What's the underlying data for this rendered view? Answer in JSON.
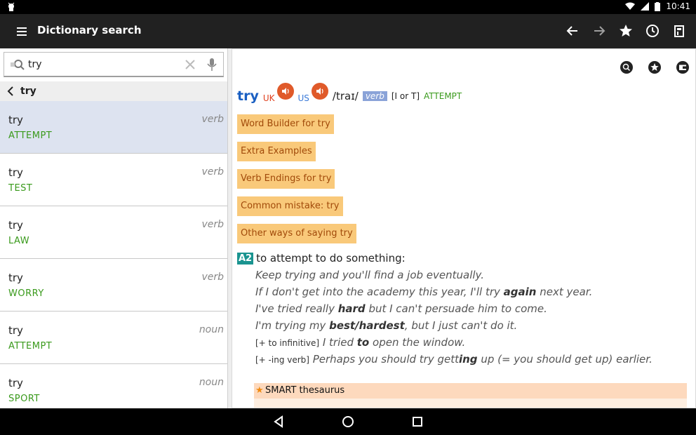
{
  "status_bar": {
    "time": "10:41"
  },
  "app_bar": {
    "title": "Dictionary search"
  },
  "search": {
    "value": "try",
    "placeholder": ""
  },
  "back_row": {
    "label": "try"
  },
  "results": [
    {
      "word": "try",
      "pos": "verb",
      "guide": "ATTEMPT"
    },
    {
      "word": "try",
      "pos": "verb",
      "guide": "TEST"
    },
    {
      "word": "try",
      "pos": "verb",
      "guide": "LAW"
    },
    {
      "word": "try",
      "pos": "verb",
      "guide": "WORRY"
    },
    {
      "word": "try",
      "pos": "noun",
      "guide": "ATTEMPT"
    },
    {
      "word": "try",
      "pos": "noun",
      "guide": "SPORT"
    }
  ],
  "entry": {
    "headword": "try",
    "uk_label": "UK",
    "us_label": "US",
    "pronunciation": "/traɪ/",
    "pos": "verb",
    "grammar": "[I or T]",
    "guideword": "ATTEMPT",
    "buttons": [
      "Word Builder for try",
      "Extra Examples",
      "Verb Endings for try",
      "Common mistake: try",
      "Other ways of saying try"
    ],
    "sense": {
      "level": "A2",
      "definition": "to attempt to do something:",
      "ex1": "Keep trying and you'll find a job eventually.",
      "ex2_a": "If I don't get into the academy this year, I'll try ",
      "ex2_b": "again",
      "ex2_c": " next year.",
      "ex3_a": "I've tried really ",
      "ex3_b": "hard",
      "ex3_c": " but I can't persuade him to come.",
      "ex4_a": "I'm trying my ",
      "ex4_b": "best/hardest",
      "ex4_c": ", but I just can't do it.",
      "ex5_note": "[+ to infinitive]",
      "ex5_a": " I tried ",
      "ex5_b": "to",
      "ex5_c": " open the window.",
      "ex6_note": "[+ -ing verb]",
      "ex6_a": " Perhaps you should try gett",
      "ex6_b": "ing",
      "ex6_c": " up (= you should get up) earlier."
    },
    "thesaurus": "SMART thesaurus"
  }
}
